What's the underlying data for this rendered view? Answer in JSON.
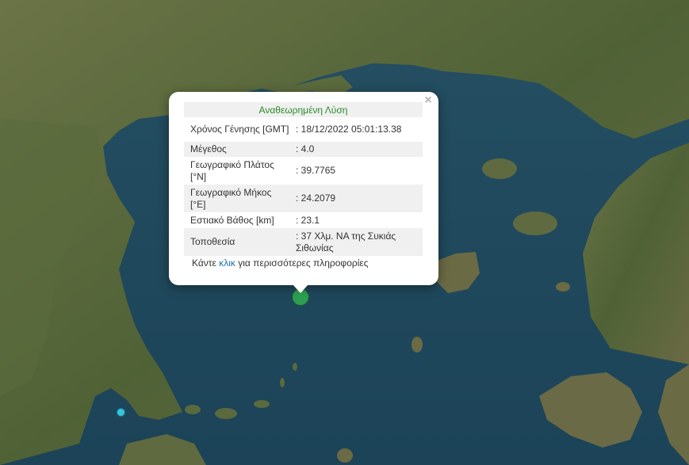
{
  "popup": {
    "title": "Αναθεωρημένη Λύση",
    "close_label": "×",
    "rows": [
      {
        "label": "Χρόνος Γένησης [GMT]",
        "value": ": 18/12/2022 05:01:13.38"
      },
      {
        "label": "Μέγεθος",
        "value": ": 4.0"
      },
      {
        "label": "Γεωγραφικό Πλάτος [°N]",
        "value": ": 39.7765"
      },
      {
        "label": "Γεωγραφικό Μήκος [°E]",
        "value": ": 24.2079"
      },
      {
        "label": "Εστιακό Βάθος [km]",
        "value": ": 23.1"
      },
      {
        "label": "Τοποθεσία",
        "value": ": 37 Χλμ. ΝΑ της Συκιάς Σιθωνίας"
      }
    ],
    "more_prefix": "Κάντε ",
    "more_link": "κλικ",
    "more_suffix": " για περισσότερες πληροφορίες"
  },
  "colors": {
    "sea": "#1f4a60",
    "land": "#5c6b3e",
    "title_green": "#2b8a2b",
    "marker_green": "#2e9e52",
    "marker_cyan": "#35c4e0",
    "link": "#1a6fb3"
  }
}
